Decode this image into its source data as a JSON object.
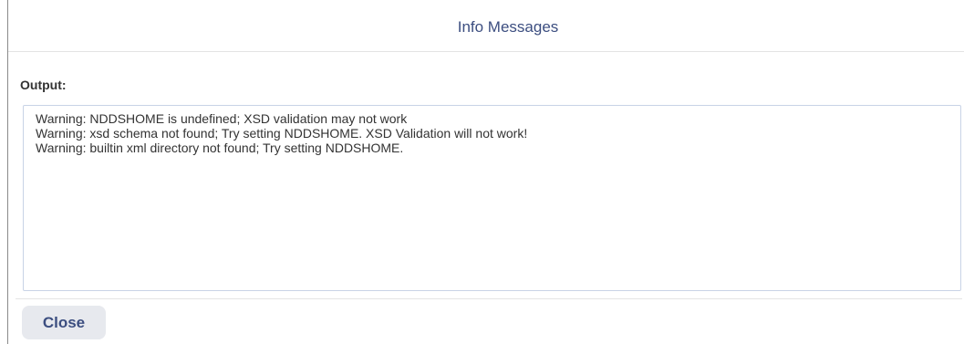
{
  "dialog": {
    "title": "Info Messages",
    "output_label": "Output:",
    "output_lines": [
      "Warning: NDDSHOME is undefined; XSD validation may not work",
      "Warning: xsd schema not found; Try setting NDDSHOME. XSD Validation will not work!",
      "Warning: builtin xml directory not found; Try setting NDDSHOME."
    ],
    "close_label": "Close"
  }
}
